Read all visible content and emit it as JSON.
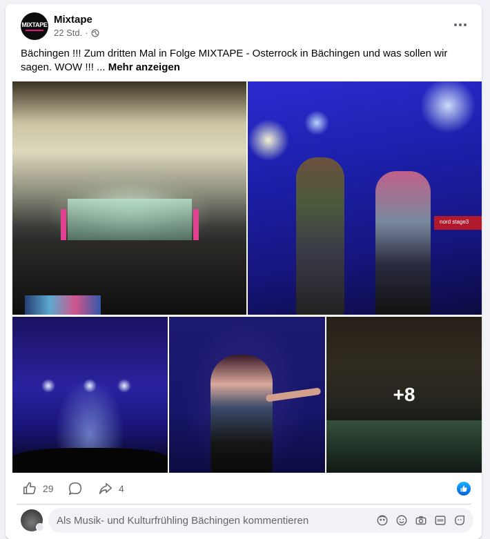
{
  "post": {
    "page_name": "Mixtape",
    "avatar_logo": "MIXTAPE",
    "time": "22 Std.",
    "separator": "·",
    "visibility_icon": "globe-icon",
    "text": "Bächingen !!! Zum dritten Mal in Folge MIXTAPE - Osterrock in Bächingen und was sollen wir sagen. WOW !!! ... ",
    "see_more": "Mehr anzeigen",
    "photos_more_count": "+8",
    "keyboard_label": "nord stage3"
  },
  "actions": {
    "like_count": "29",
    "share_count": "4",
    "like_icon": "thumbs-up-icon",
    "comment_icon": "comment-icon",
    "share_icon": "share-icon",
    "reaction_badge_icon": "like-reaction-icon"
  },
  "comment": {
    "placeholder": "Als Musik- und Kulturfrühling Bächingen kommentieren",
    "icons": [
      "avatar-sticker-icon",
      "emoji-icon",
      "camera-icon",
      "gif-icon",
      "sticker-icon"
    ]
  },
  "colors": {
    "brand_pink": "#e0147c",
    "facebook_blue": "#0866ff",
    "text_secondary": "#65676b"
  }
}
